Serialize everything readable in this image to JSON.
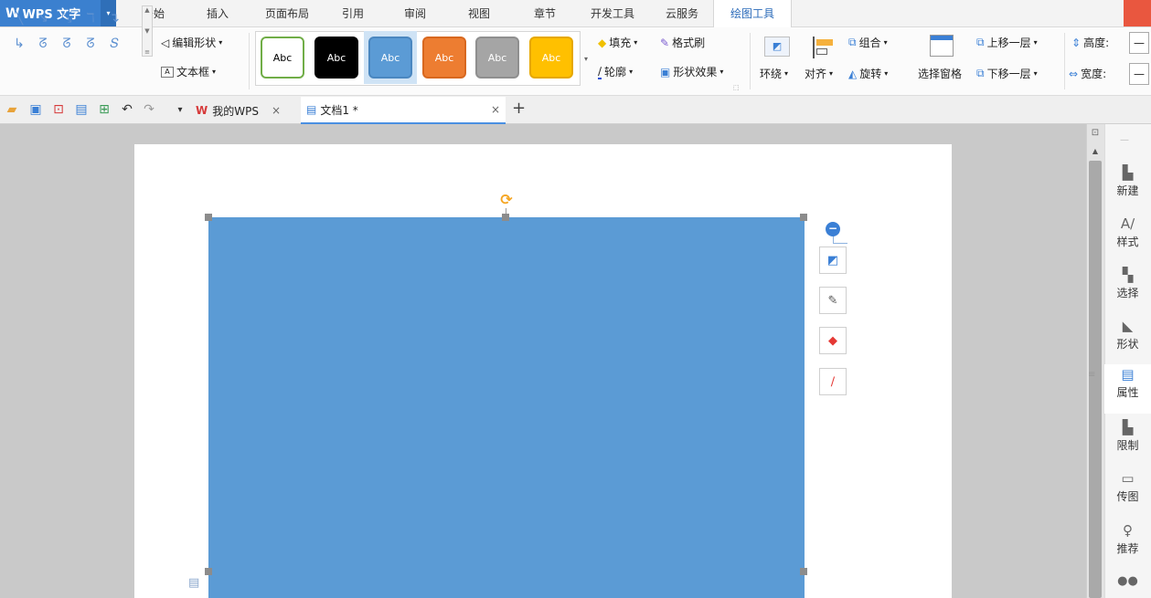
{
  "app": {
    "logo": "W",
    "name": "WPS 文字"
  },
  "menu": {
    "tabs": [
      {
        "label": "开始"
      },
      {
        "label": "插入"
      },
      {
        "label": "页面布局"
      },
      {
        "label": "引用"
      },
      {
        "label": "审阅"
      },
      {
        "label": "视图"
      },
      {
        "label": "章节"
      },
      {
        "label": "开发工具"
      },
      {
        "label": "云服务"
      },
      {
        "label": "绘图工具"
      }
    ],
    "active_tab": "绘图工具"
  },
  "ribbon": {
    "edit_shape": "编辑形状",
    "text_box": "文本框",
    "style_swatches": [
      {
        "label": "Abc",
        "bg": "#ffffff",
        "border": "#70ad47",
        "color": "#000000"
      },
      {
        "label": "Abc",
        "bg": "#000000",
        "border": "#000000",
        "color": "#ffffff"
      },
      {
        "label": "Abc",
        "bg": "#5b9bd5",
        "border": "#4a87c0",
        "color": "#ffffff"
      },
      {
        "label": "Abc",
        "bg": "#ed7d31",
        "border": "#d8681f",
        "color": "#ffffff"
      },
      {
        "label": "Abc",
        "bg": "#a5a5a5",
        "border": "#8f8f8f",
        "color": "#ffffff"
      },
      {
        "label": "Abc",
        "bg": "#ffc000",
        "border": "#e6a800",
        "color": "#ffffff"
      }
    ],
    "fill": "填充",
    "format_painter": "格式刷",
    "outline": "轮廓",
    "shape_effects": "形状效果",
    "wrap": "环绕",
    "align": "对齐",
    "group": "组合",
    "rotate": "旋转",
    "selection_pane": "选择窗格",
    "bring_forward": "上移一层",
    "send_backward": "下移一层",
    "height_label": "高度:",
    "width_label": "宽度:",
    "height_value": "—",
    "width_value": "—"
  },
  "quickbar": {
    "tabs": [
      {
        "label": "我的WPS",
        "close": "×"
      },
      {
        "label": "文档1 *",
        "close": "×"
      }
    ],
    "new_tab": "+"
  },
  "sidepanel": {
    "items": [
      {
        "label": "新建",
        "icon": "new-doc-icon",
        "glyph": "▙"
      },
      {
        "label": "样式",
        "icon": "style-icon",
        "glyph": "A∕"
      },
      {
        "label": "选择",
        "icon": "select-icon",
        "glyph": "▚"
      },
      {
        "label": "形状",
        "icon": "shape-icon",
        "glyph": "◣"
      },
      {
        "label": "属性",
        "icon": "properties-icon",
        "glyph": "▤"
      },
      {
        "label": "限制",
        "icon": "restrict-icon",
        "glyph": "▙"
      },
      {
        "label": "传图",
        "icon": "upload-image-icon",
        "glyph": "▭"
      },
      {
        "label": "推荐",
        "icon": "recommend-icon",
        "glyph": "♀"
      },
      {
        "label": "",
        "icon": "users-icon",
        "glyph": "👥"
      }
    ],
    "active": "属性"
  },
  "colors": {
    "accent": "#3b80cf",
    "shape_fill": "#5b9bd5",
    "rotate_handle": "#f5a623"
  }
}
